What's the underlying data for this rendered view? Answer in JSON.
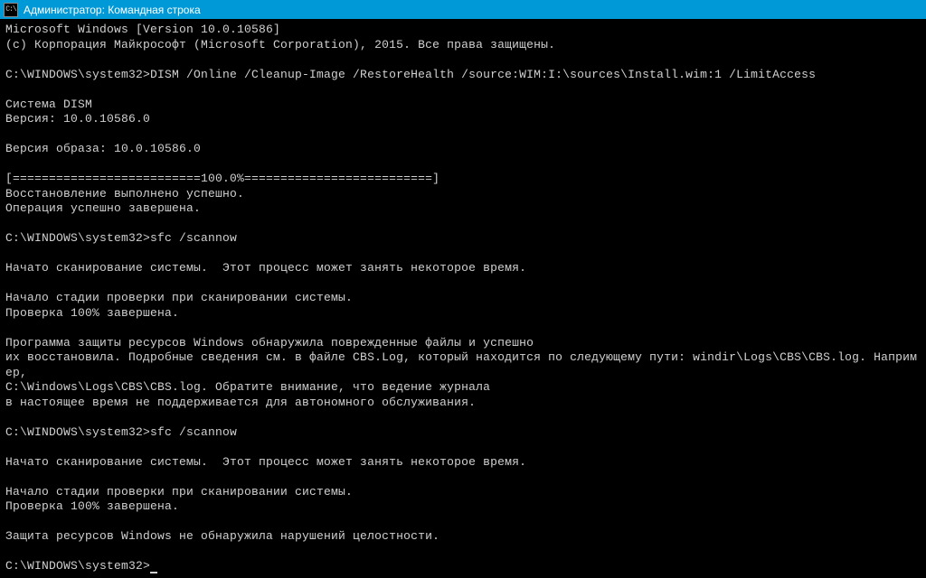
{
  "titlebar": {
    "icon_label": "C:\\",
    "title": "Администратор: Командная строка"
  },
  "terminal": {
    "lines": [
      "Microsoft Windows [Version 10.0.10586]",
      "(c) Корпорация Майкрософт (Microsoft Corporation), 2015. Все права защищены.",
      "",
      "C:\\WINDOWS\\system32>DISM /Online /Cleanup-Image /RestoreHealth /source:WIM:I:\\sources\\Install.wim:1 /LimitAccess",
      "",
      "Cистема DISM",
      "Версия: 10.0.10586.0",
      "",
      "Версия образа: 10.0.10586.0",
      "",
      "[==========================100.0%==========================]",
      "Восстановление выполнено успешно.",
      "Операция успешно завершена.",
      "",
      "C:\\WINDOWS\\system32>sfc /scannow",
      "",
      "Начато сканирование системы.  Этот процесс может занять некоторое время.",
      "",
      "Начало стадии проверки при сканировании системы.",
      "Проверка 100% завершена.",
      "",
      "Программа защиты ресурсов Windows обнаружила поврежденные файлы и успешно",
      "их восстановила. Подробные сведения см. в файле CBS.Log, который находится по следующему пути: windir\\Logs\\CBS\\CBS.log. Например,",
      "C:\\Windows\\Logs\\CBS\\CBS.log. Обратите внимание, что ведение журнала",
      "в настоящее время не поддерживается для автономного обслуживания.",
      "",
      "C:\\WINDOWS\\system32>sfc /scannow",
      "",
      "Начато сканирование системы.  Этот процесс может занять некоторое время.",
      "",
      "Начало стадии проверки при сканировании системы.",
      "Проверка 100% завершена.",
      "",
      "Защита ресурсов Windows не обнаружила нарушений целостности.",
      ""
    ],
    "prompt": "C:\\WINDOWS\\system32>"
  }
}
